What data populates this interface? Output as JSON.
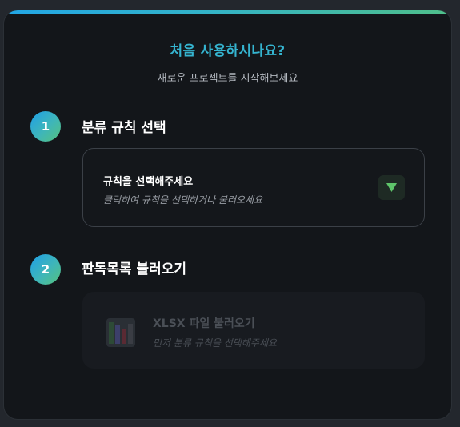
{
  "header": {
    "title": "처음 사용하시나요?",
    "subtitle": "새로운 프로젝트를 시작해보세요"
  },
  "steps": [
    {
      "number": "1",
      "title": "분류 규칙 선택",
      "box": {
        "main": "규칙을 선택해주세요",
        "sub": "클릭하여 규칙을 선택하거나 불러오세요",
        "icon": "chevron-down-icon"
      }
    },
    {
      "number": "2",
      "title": "판독목록 불러오기",
      "box": {
        "main": "XLSX 파일 불러오기",
        "sub": "먼저 분류 규칙을 선택해주세요",
        "icon": "spreadsheet-icon",
        "disabled": true
      }
    }
  ],
  "colors": {
    "accent": "#35b4d0",
    "background": "#13161a",
    "dropdown_arrow": "#5ec46a"
  }
}
